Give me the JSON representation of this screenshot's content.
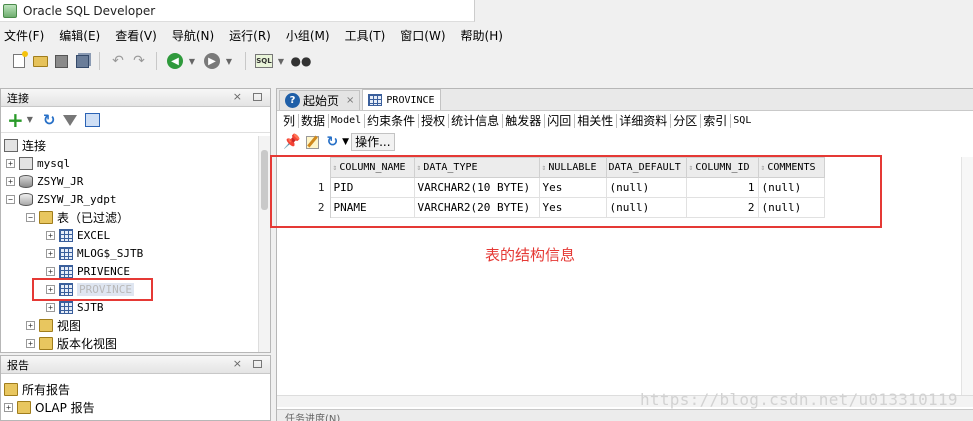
{
  "window": {
    "title": "Oracle SQL Developer"
  },
  "menu": [
    "文件(F)",
    "编辑(E)",
    "查看(V)",
    "导航(N)",
    "运行(R)",
    "小组(M)",
    "工具(T)",
    "窗口(W)",
    "帮助(H)"
  ],
  "connections_panel": {
    "title": "连接",
    "tree": [
      {
        "label": "连接",
        "icon": "connections-root-icon"
      },
      {
        "label": "mysql",
        "icon": "connection-icon"
      },
      {
        "label": "ZSYW_JR",
        "icon": "database-icon"
      },
      {
        "label": "ZSYW_JR_ydpt",
        "icon": "database-open-icon"
      },
      {
        "label": "表（已过滤）",
        "icon": "folder-icon"
      },
      {
        "label": "EXCEL",
        "icon": "table-icon"
      },
      {
        "label": "MLOG$_SJTB",
        "icon": "table-icon"
      },
      {
        "label": "PRIVENCE",
        "icon": "table-icon"
      },
      {
        "label": "PROVINCE",
        "icon": "table-icon"
      },
      {
        "label": "SJTB",
        "icon": "table-icon"
      },
      {
        "label": "视图",
        "icon": "folder-icon"
      },
      {
        "label": "版本化视图",
        "icon": "folder-icon"
      }
    ]
  },
  "reports_panel": {
    "title": "报告",
    "tree": [
      {
        "label": "所有报告",
        "icon": "reports-icon"
      },
      {
        "label": "OLAP 报告",
        "icon": "folder-icon"
      }
    ]
  },
  "editor": {
    "tabs": [
      {
        "label": "起始页",
        "icon": "help-icon"
      },
      {
        "label": "PROVINCE",
        "icon": "table-icon"
      }
    ],
    "sub_tabs": [
      "列",
      "数据",
      "Model",
      "约束条件",
      "授权",
      "统计信息",
      "触发器",
      "闪回",
      "相关性",
      "详细资料",
      "分区",
      "索引",
      "SQL"
    ],
    "actions_label": "操作...",
    "grid": {
      "columns": [
        "COLUMN_NAME",
        "DATA_TYPE",
        "NULLABLE",
        "DATA_DEFAULT",
        "COLUMN_ID",
        "COMMENTS"
      ],
      "rows": [
        {
          "n": "1",
          "cells": [
            "PID",
            "VARCHAR2(10 BYTE)",
            "Yes",
            "(null)",
            "1",
            "(null)"
          ]
        },
        {
          "n": "2",
          "cells": [
            "PNAME",
            "VARCHAR2(20 BYTE)",
            "Yes",
            "(null)",
            "2",
            "(null)"
          ]
        }
      ]
    },
    "bottom_panel_label": "任务进度(N)"
  },
  "annotation": "表的结构信息",
  "watermark": "https://blog.csdn.net/u013310119",
  "colors": {
    "highlight": "#e53935",
    "annotation": "#e53935"
  }
}
